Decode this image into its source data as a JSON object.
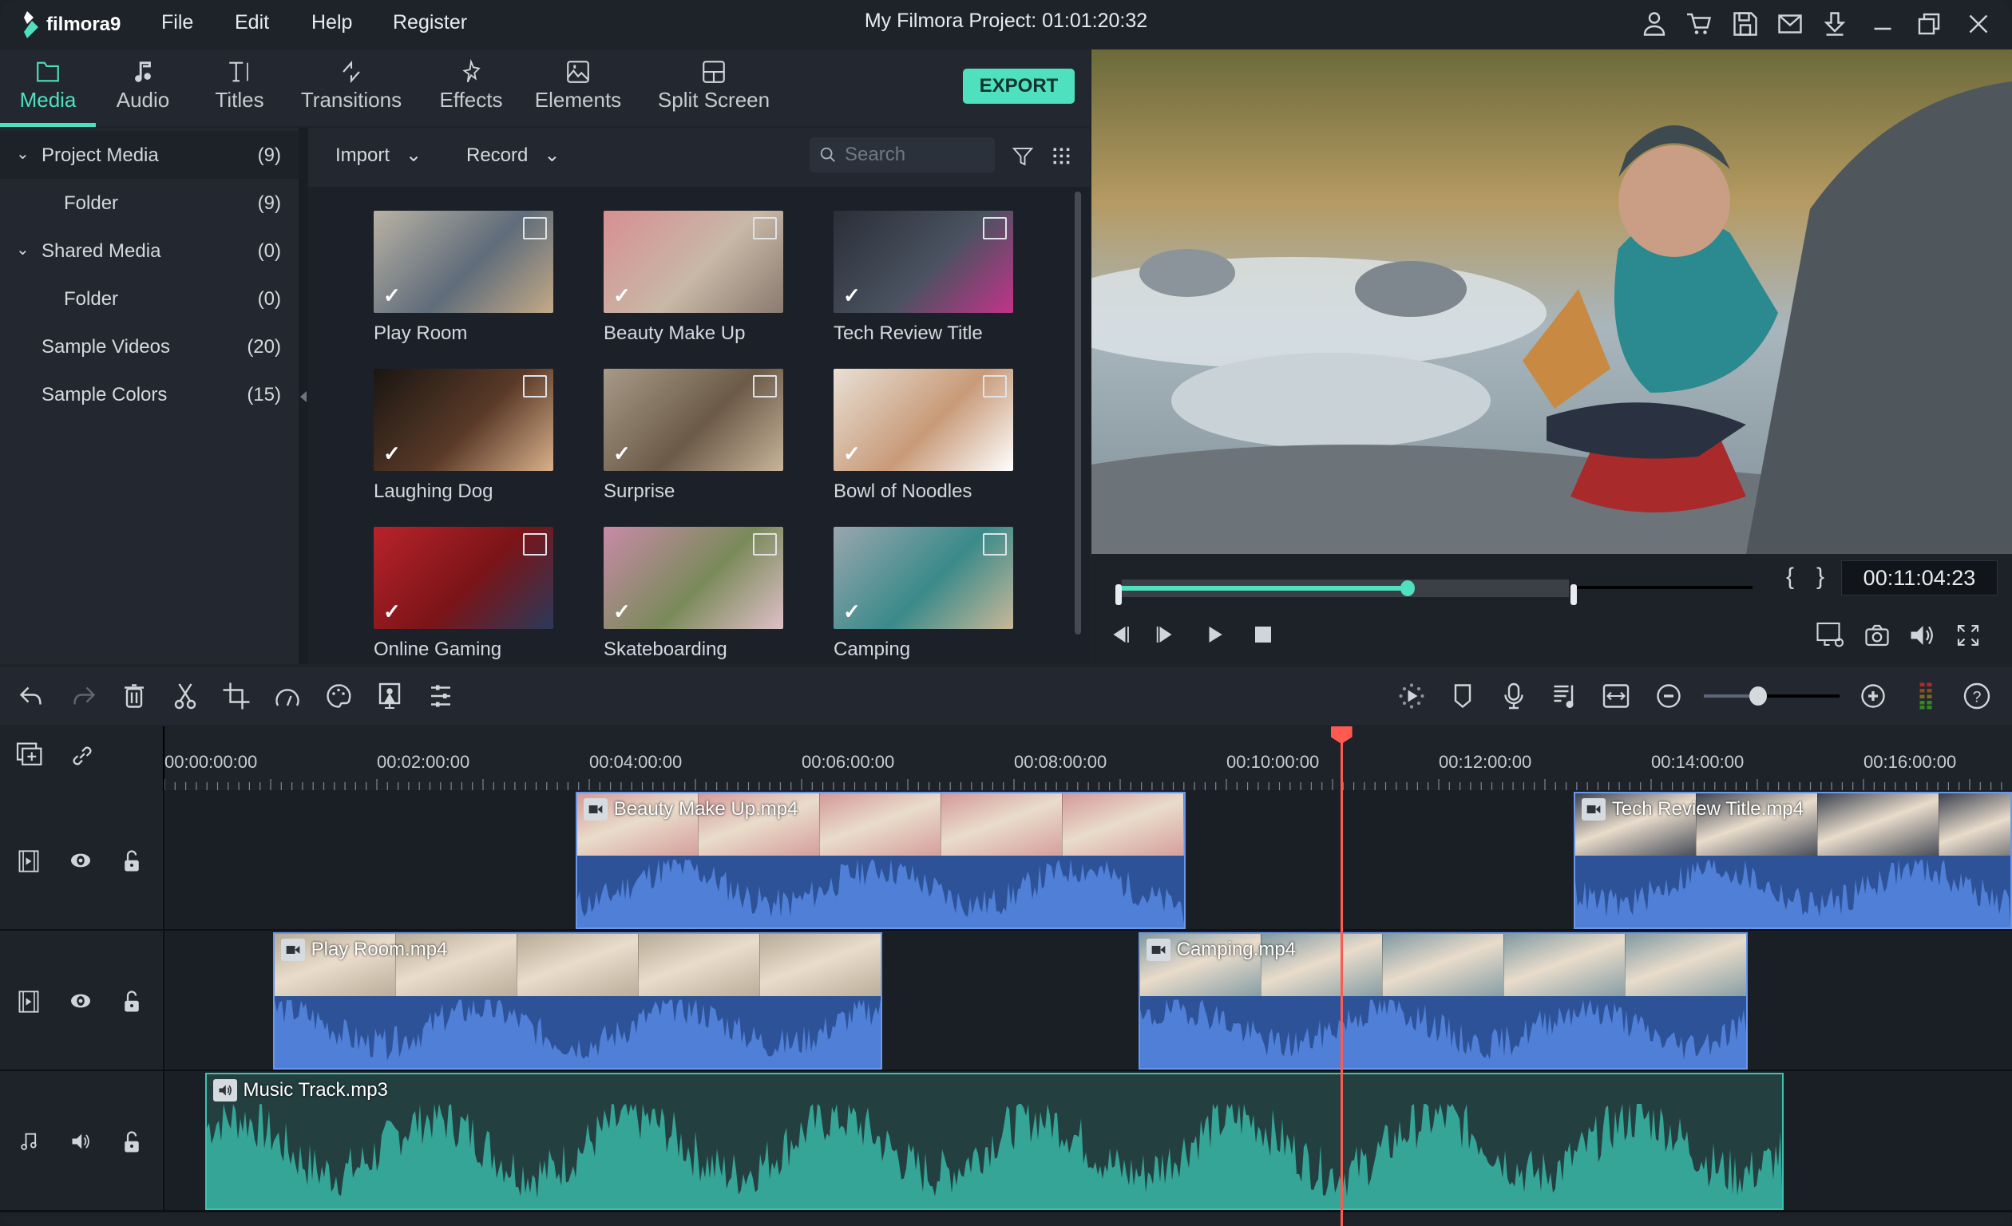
{
  "app": {
    "logo_text": "filmora9",
    "menu": [
      "File",
      "Edit",
      "Help",
      "Register"
    ],
    "project_title": "My Filmora Project: 01:01:20:32",
    "title_icons": [
      "account-icon",
      "cart-icon",
      "save-icon",
      "mail-icon",
      "download-icon",
      "minimize-icon",
      "restore-icon",
      "close-icon"
    ]
  },
  "tabs": [
    {
      "label": "Media",
      "icon": "folder-icon",
      "active": true
    },
    {
      "label": "Audio",
      "icon": "music-note-icon"
    },
    {
      "label": "Titles",
      "icon": "text-icon"
    },
    {
      "label": "Transitions",
      "icon": "transitions-icon"
    },
    {
      "label": "Effects",
      "icon": "effects-icon"
    },
    {
      "label": "Elements",
      "icon": "image-icon"
    },
    {
      "label": "Split Screen",
      "icon": "split-screen-icon"
    }
  ],
  "export_label": "EXPORT",
  "folders": [
    {
      "label": "Project Media",
      "count": "(9)",
      "expandable": true,
      "selected": true
    },
    {
      "label": "Folder",
      "count": "(9)",
      "indent": true
    },
    {
      "label": "Shared Media",
      "count": "(0)",
      "expandable": true
    },
    {
      "label": "Folder",
      "count": "(0)",
      "indent": true
    },
    {
      "label": "Sample Videos",
      "count": "(20)"
    },
    {
      "label": "Sample Colors",
      "count": "(15)"
    }
  ],
  "library": {
    "import_label": "Import",
    "record_label": "Record",
    "search_placeholder": "Search",
    "items": [
      {
        "label": "Play Room",
        "colors": [
          "#b9b2a4",
          "#5f6c7a",
          "#c3aa86"
        ]
      },
      {
        "label": "Beauty Make Up",
        "colors": [
          "#d88f92",
          "#c8b8a6",
          "#8a7a70"
        ]
      },
      {
        "label": "Tech Review Title",
        "colors": [
          "#2a2f38",
          "#4a5260",
          "#c2338a"
        ]
      },
      {
        "label": "Laughing Dog",
        "colors": [
          "#1a1612",
          "#5a3a28",
          "#d9b08a"
        ]
      },
      {
        "label": "Surprise",
        "colors": [
          "#a89a88",
          "#6b5a48",
          "#c8b49a"
        ]
      },
      {
        "label": "Bowl of Noodles",
        "colors": [
          "#e8e0d4",
          "#c89a78",
          "#ffffff"
        ]
      },
      {
        "label": "Online Gaming",
        "colors": [
          "#b8232a",
          "#7a1418",
          "#2a3a5a"
        ]
      },
      {
        "label": "Skateboarding",
        "colors": [
          "#c88aa8",
          "#7a8a5a",
          "#e0c0c8"
        ]
      },
      {
        "label": "Camping",
        "colors": [
          "#9aa6ae",
          "#3a8a8a",
          "#c8b898"
        ]
      }
    ]
  },
  "preview": {
    "timecode": "00:11:04:23",
    "progress_fraction": 0.64,
    "mark_in": "{",
    "mark_out": "}"
  },
  "timeline_toolbar": {
    "left_icons": [
      "undo-icon",
      "redo-icon",
      "delete-icon",
      "cut-icon",
      "crop-icon",
      "speed-icon",
      "color-icon",
      "green-screen-icon",
      "adjust-icon"
    ],
    "right_icons": [
      "render-icon",
      "marker-icon",
      "voiceover-icon",
      "audio-mixer-icon",
      "fit-timeline-icon",
      "zoom-out-icon",
      "zoom-in-icon",
      "audio-meter-icon",
      "help-icon"
    ],
    "zoom_fraction": 0.4
  },
  "ruler": {
    "labels": [
      "00:00:00:00",
      "00:02:00:00",
      "00:04:00:00",
      "00:06:00:00",
      "00:08:00:00",
      "00:10:00:00",
      "00:12:00:00",
      "00:14:00:00",
      "00:16:00:00"
    ]
  },
  "tracks": [
    {
      "type": "video",
      "clips": [
        {
          "name": "Beauty Make Up.mp4",
          "start_min": 3.87,
          "end_min": 9.62,
          "frame_color": "#d49a98"
        },
        {
          "name": "Tech Review Title.mp4",
          "start_min": 13.27,
          "end_min": 17.5,
          "frame_color": "#3a4250"
        }
      ]
    },
    {
      "type": "video",
      "clips": [
        {
          "name": "Play Room.mp4",
          "start_min": 1.02,
          "end_min": 6.76,
          "frame_color": "#b6ab96"
        },
        {
          "name": "Camping.mp4",
          "start_min": 9.17,
          "end_min": 14.91,
          "frame_color": "#7f99a2"
        }
      ]
    },
    {
      "type": "audio",
      "clips": [
        {
          "name": "Music Track.mp3",
          "start_min": 0.38,
          "end_min": 15.25
        }
      ]
    }
  ],
  "playhead_min": 11.08,
  "colors": {
    "accent": "#4fe0c0",
    "video_clip": "#4f7fd6",
    "audio_clip": "#34a596",
    "playhead": "#ff5a51"
  }
}
